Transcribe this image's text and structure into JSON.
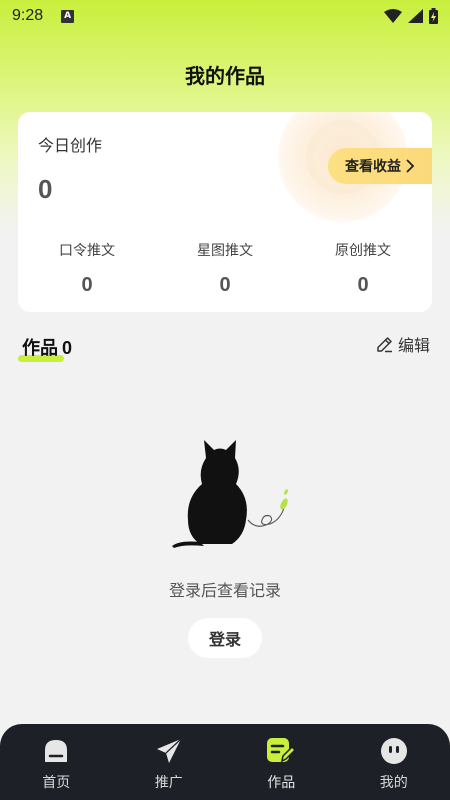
{
  "status_bar": {
    "time": "9:28",
    "notification_icon": "a-letter-icon",
    "icons": [
      "wifi-icon",
      "signal-icon",
      "battery-charging-icon"
    ]
  },
  "page": {
    "title": "我的作品"
  },
  "stats_card": {
    "today_label": "今日创作",
    "today_value": "0",
    "earnings_button": "查看收益",
    "stats": [
      {
        "label": "口令推文",
        "value": "0"
      },
      {
        "label": "星图推文",
        "value": "0"
      },
      {
        "label": "原创推文",
        "value": "0"
      }
    ]
  },
  "works": {
    "title": "作品",
    "count": "0",
    "edit_label": "编辑"
  },
  "empty_state": {
    "message": "登录后查看记录",
    "login_button": "登录"
  },
  "tab_bar": {
    "items": [
      {
        "label": "首页",
        "icon": "home-icon"
      },
      {
        "label": "推广",
        "icon": "paper-plane-icon"
      },
      {
        "label": "作品",
        "icon": "works-icon",
        "active": true
      },
      {
        "label": "我的",
        "icon": "profile-face-icon"
      }
    ]
  },
  "colors": {
    "accent": "#c9ef3c",
    "tab_bar_bg": "#1d2026",
    "earnings_button": "#fde082",
    "page_bg": "#f2f2f2"
  }
}
